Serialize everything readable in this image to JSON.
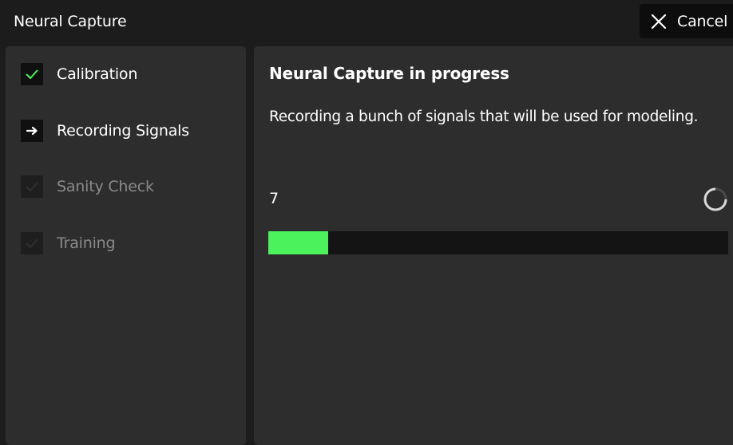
{
  "app": {
    "title": "Neural Capture"
  },
  "toolbar": {
    "cancel_label": "Cancel",
    "cancel_icon": "close-icon"
  },
  "steps": [
    {
      "label": "Calibration",
      "state": "done",
      "icon": "checkmark-icon"
    },
    {
      "label": "Recording Signals",
      "state": "active",
      "icon": "arrow-right-icon"
    },
    {
      "label": "Sanity Check",
      "state": "pending",
      "icon": "checkmark-icon"
    },
    {
      "label": "Training",
      "state": "pending",
      "icon": "checkmark-icon"
    }
  ],
  "main": {
    "title": "Neural Capture in progress",
    "description": "Recording a bunch of signals that will be used for modeling.",
    "counter": "7",
    "progress_percent": 13,
    "spinner_icon": "loading-spinner-icon"
  },
  "colors": {
    "background": "#1c1c1c",
    "panel": "#2d2d2d",
    "accent_green": "#4bf25b",
    "pending_text": "#8a8a8a",
    "track": "#141414"
  }
}
